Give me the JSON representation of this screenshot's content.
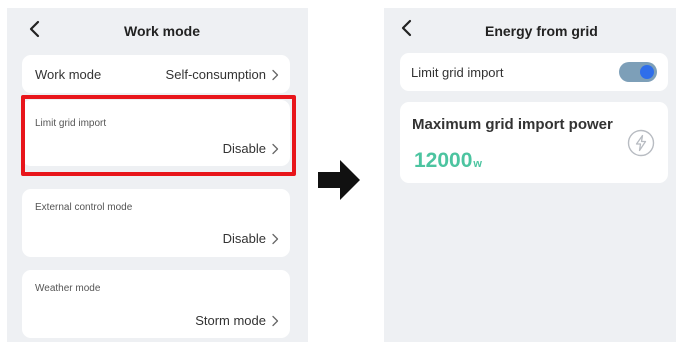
{
  "left_screen": {
    "title": "Work mode",
    "rows": [
      {
        "label": "Work mode",
        "value": "Self-consumption"
      },
      {
        "label": "Limit grid import",
        "value": "Disable"
      },
      {
        "label": "External control mode",
        "value": "Disable"
      },
      {
        "label": "Weather mode",
        "value": "Storm mode"
      }
    ]
  },
  "right_screen": {
    "title": "Energy from grid",
    "limit_grid_import": {
      "label": "Limit grid import",
      "enabled": true
    },
    "max_power": {
      "label": "Maximum grid import power",
      "value": "12000",
      "unit": "w"
    }
  },
  "icons": {
    "back": "chevron-left-icon",
    "row_chevron": "chevron-right-icon",
    "transition_arrow": "arrow-right-icon",
    "power": "lightning-bolt-icon"
  },
  "colors": {
    "highlight": "#e8151b",
    "toggle_knob": "#2f6eea",
    "toggle_track": "#7d9fb8",
    "power_value": "#4cc4a0"
  }
}
